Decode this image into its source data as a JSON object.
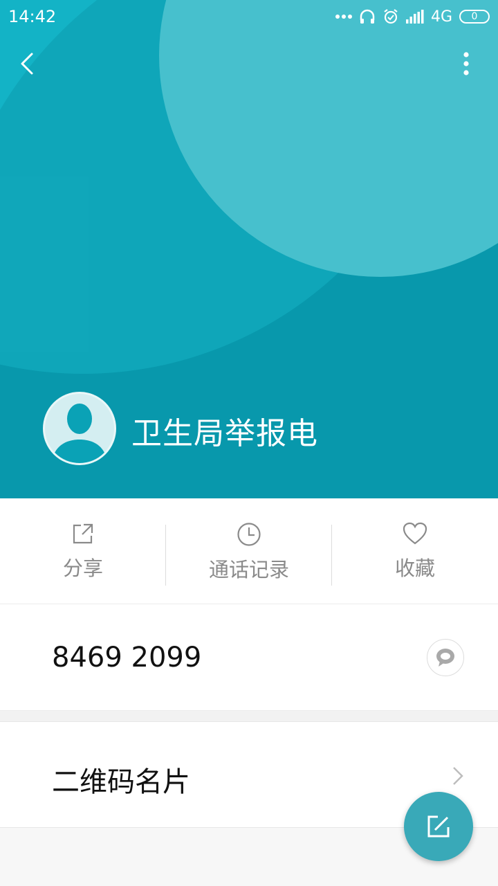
{
  "status_bar": {
    "time": "14:42",
    "network": "4G",
    "battery_level": "0",
    "icons": [
      "more-dots-icon",
      "headphones-icon",
      "alarm-icon",
      "signal-icon",
      "battery-icon"
    ]
  },
  "header": {
    "background_color": "#0aa2b6",
    "icons": [
      "back-arrow-icon",
      "more-vertical-icon"
    ]
  },
  "contact": {
    "name": "卫生局举报电",
    "avatar_icon": "person-silhouette-icon"
  },
  "actions": [
    {
      "label": "分享",
      "icon": "share-icon"
    },
    {
      "label": "通话记录",
      "icon": "clock-icon"
    },
    {
      "label": "收藏",
      "icon": "heart-icon"
    }
  ],
  "phone": {
    "number": "8469 2099",
    "sms_icon": "message-bubble-icon"
  },
  "qr_card": {
    "label": "二维码名片",
    "icon": "chevron-right-icon"
  },
  "fab": {
    "icon": "edit-icon",
    "color": "#39a9b8"
  }
}
